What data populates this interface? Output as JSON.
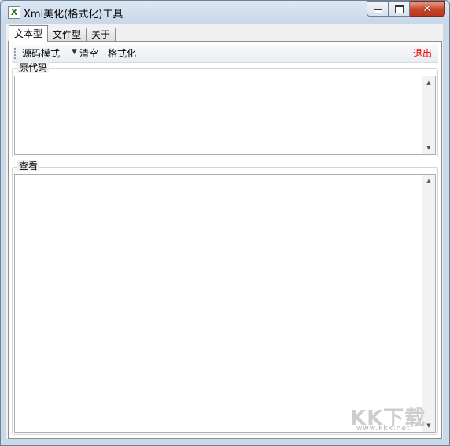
{
  "window": {
    "title": "Xml美化(格式化)工具",
    "app_icon": "X"
  },
  "tabs": [
    {
      "label": "文本型",
      "active": true
    },
    {
      "label": "文件型",
      "active": false
    },
    {
      "label": "关于",
      "active": false
    }
  ],
  "toolbar": {
    "mode_dropdown": "源码模式",
    "clear": "清空",
    "format": "格式化",
    "exit": "退出",
    "exit_color": "#e00000"
  },
  "source_group": {
    "label": "原代码",
    "content": ""
  },
  "view_group": {
    "label": "查看",
    "content": ""
  },
  "watermark": {
    "text": "KK下载",
    "url": "www.kkx.net"
  }
}
